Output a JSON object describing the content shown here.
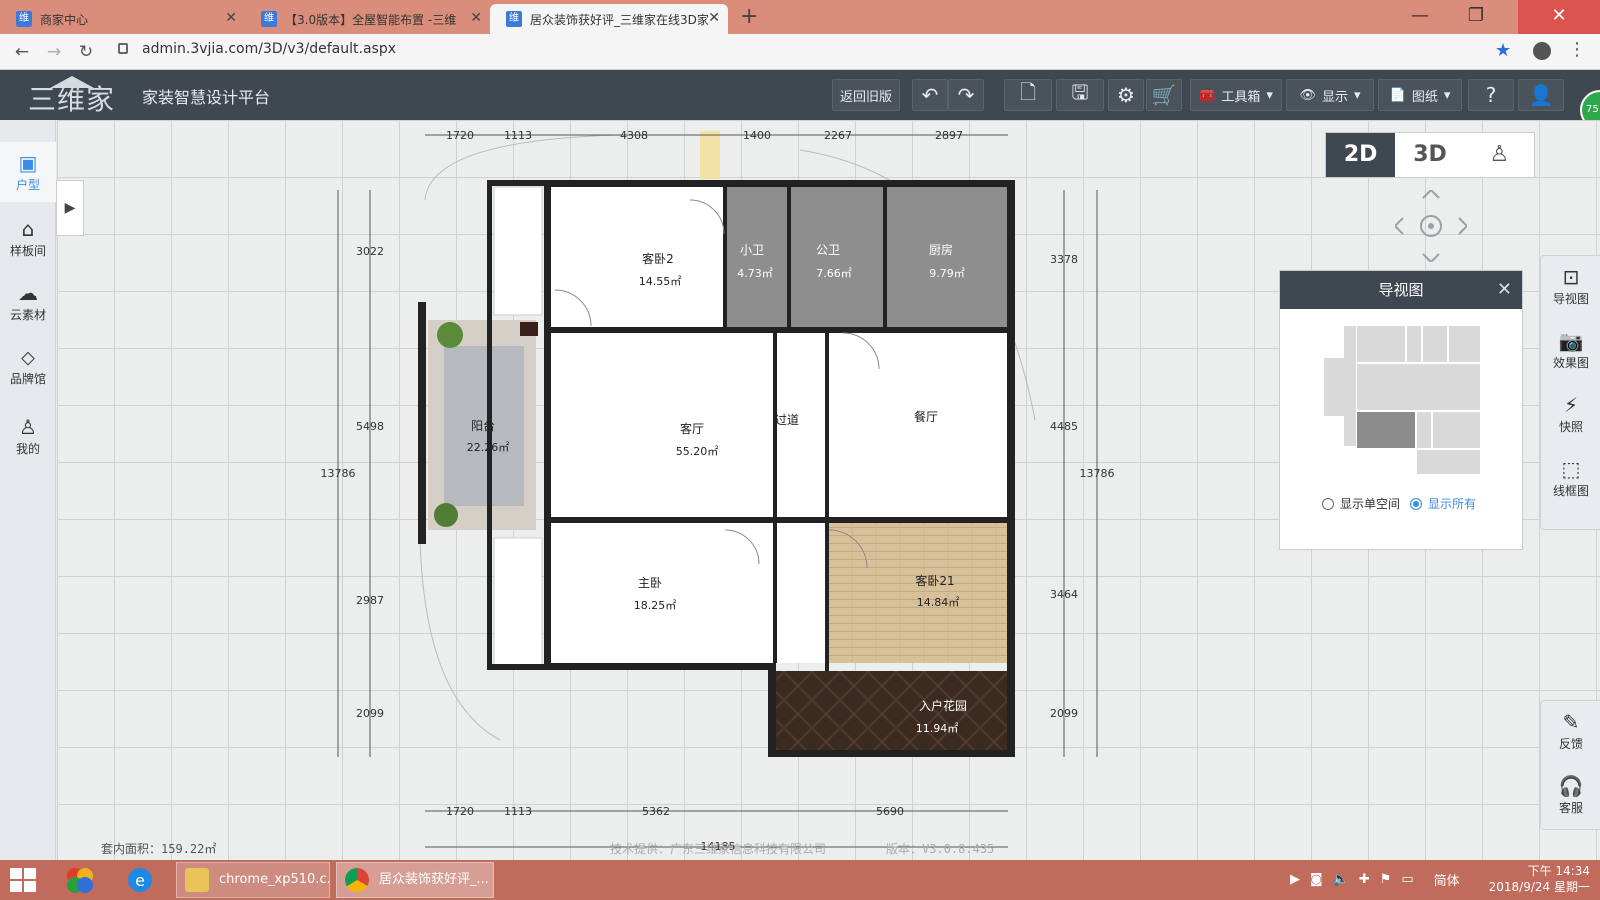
{
  "browser": {
    "tabs": [
      {
        "title": "商家中心",
        "active": false
      },
      {
        "title": "【3.0版本】全屋智能布置 -三维",
        "active": false
      },
      {
        "title": "居众装饰获好评_三维家在线3D家",
        "active": true
      }
    ],
    "new_tab": "+",
    "url": "admin.3vjia.com/3D/v3/default.aspx",
    "window_controls": {
      "minimize": "—",
      "maximize": "❐",
      "close": "✕"
    }
  },
  "header": {
    "logo_text": "三维家",
    "platform_name": "家装智慧设计平台",
    "back_old": "返回旧版",
    "toolbox": "工具箱",
    "display": "显示",
    "drawings": "图纸",
    "help_icon": "?"
  },
  "left_sidebar": {
    "items": [
      {
        "label": "户型",
        "icon": "floorplan-icon",
        "active": true
      },
      {
        "label": "样板间",
        "icon": "house-icon",
        "active": false
      },
      {
        "label": "云素材",
        "icon": "cloud-icon",
        "active": false
      },
      {
        "label": "品牌馆",
        "icon": "tag-icon",
        "active": false
      },
      {
        "label": "我的",
        "icon": "user-icon",
        "active": false
      }
    ]
  },
  "view_switch": {
    "options": [
      "2D",
      "3D",
      "👤"
    ],
    "selected": "2D"
  },
  "rooms": [
    {
      "name": "客卧2",
      "area": "14.55㎡"
    },
    {
      "name": "小卫",
      "area": "4.73㎡"
    },
    {
      "name": "公卫",
      "area": "7.66㎡"
    },
    {
      "name": "厨房",
      "area": "9.79㎡"
    },
    {
      "name": "阳台",
      "area": "22.26㎡"
    },
    {
      "name": "客厅",
      "area": "55.20㎡"
    },
    {
      "name": "过道",
      "area": ""
    },
    {
      "name": "餐厅",
      "area": ""
    },
    {
      "name": "主卧",
      "area": "18.25㎡"
    },
    {
      "name": "客卧21",
      "area": "14.84㎡"
    },
    {
      "name": "入户花园",
      "area": "11.94㎡"
    }
  ],
  "dimensions": {
    "top": [
      "1720",
      "1113",
      "4308",
      "1400",
      "2267",
      "2897"
    ],
    "bottom": [
      "1720",
      "1113",
      "5362",
      "5690"
    ],
    "bottom_total": "14185",
    "left": [
      "3022",
      "5498",
      "2987",
      "2099"
    ],
    "left_total": "13786",
    "right": [
      "3378",
      "4485",
      "3464",
      "2099"
    ],
    "right_total": "13786"
  },
  "minimap_panel": {
    "title": "导视图",
    "close": "✕",
    "option_single": "显示单空间",
    "option_all": "显示所有",
    "selected": "显示所有"
  },
  "right_tools": {
    "top": [
      {
        "label": "导视图",
        "icon": "map-icon"
      },
      {
        "label": "效果图",
        "icon": "camera-icon"
      },
      {
        "label": "快照",
        "icon": "snapshot-icon"
      },
      {
        "label": "线框图",
        "icon": "wireframe-icon"
      }
    ],
    "bottom": [
      {
        "label": "反馈",
        "icon": "feedback-icon"
      },
      {
        "label": "客服",
        "icon": "headset-icon"
      }
    ]
  },
  "status": {
    "area_label": "套内面积：159.22㎡",
    "tech_support": "技术提供：广东三维家信息科技有限公司",
    "version": "版本：V3.0.8.435",
    "badge": "75"
  },
  "taskbar": {
    "tasks": [
      "chrome_xp510.c...",
      "居众装饰获好评_..."
    ],
    "ime": "简体",
    "time": "下午 14:34",
    "date": "2018/9/24 星期一"
  }
}
